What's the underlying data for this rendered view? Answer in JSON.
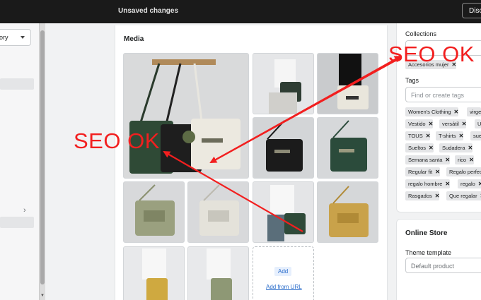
{
  "topbar": {
    "title": "Unsaved changes",
    "discard_label": "Disc"
  },
  "left": {
    "select_value": "ory"
  },
  "media": {
    "title": "Media",
    "add_label": "Add",
    "add_url_label": "Add from URL"
  },
  "organization": {
    "collections_label": "Collections",
    "collection_tag": "Accesorios mujer",
    "tags_label": "Tags",
    "tags_placeholder": "Find or create tags",
    "tags": [
      [
        "Women's Clothing",
        "virge"
      ],
      [
        "Vestido",
        "versátil",
        "U"
      ],
      [
        "TOUS",
        "T-shirts",
        "sue"
      ],
      [
        "Sueltos",
        "Sudadera"
      ],
      [
        "Semana santa",
        "rico"
      ],
      [
        "Regular fit",
        "Regalo perfec"
      ],
      [
        "regalo hombre",
        "regalo"
      ],
      [
        "Rasgados",
        "Que regalar"
      ]
    ]
  },
  "online_store": {
    "title": "Online Store",
    "theme_label": "Theme template",
    "theme_value": "Default product"
  },
  "annotations": {
    "text1": "SEO OK",
    "text2": "SEO OK",
    "color": "#f21f1f"
  },
  "icons": {
    "close": "x-icon",
    "caret": "caret-down-icon",
    "chevron": "chevron-right-icon"
  }
}
